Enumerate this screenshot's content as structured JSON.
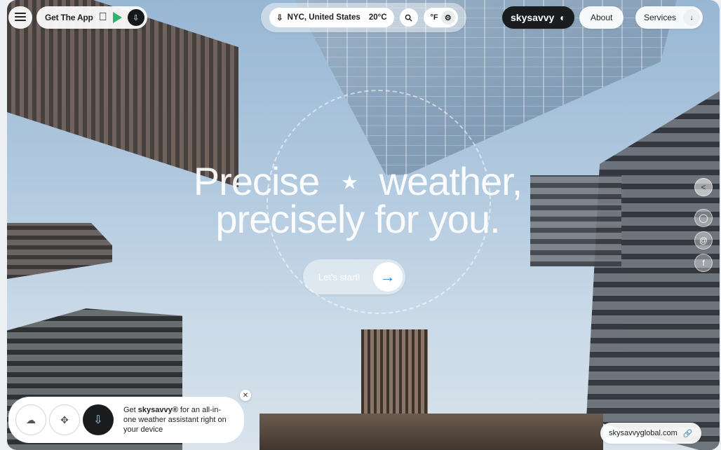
{
  "header": {
    "menu_icon": "hamburger-icon",
    "get_app_label": "Get The App",
    "location": "NYC, United States",
    "temperature": "20°C",
    "unit_label": "°F",
    "brand": "skysavvy",
    "about_label": "About",
    "services_label": "Services"
  },
  "hero": {
    "line1_a": "Precise",
    "line1_b": "weather,",
    "line2": "precisely for you.",
    "cta_label": "Let's start!"
  },
  "social": {
    "icons": [
      "share-icon",
      "instagram-icon",
      "threads-icon",
      "facebook-icon"
    ]
  },
  "promo": {
    "text_pre": "Get ",
    "brand": "skysavvy®",
    "text_post": " for an all-in-one weather assistant right on your device"
  },
  "footer": {
    "site": "skysavvyglobal.com"
  },
  "colors": {
    "accent": "#2a7fd8",
    "dark": "#1b1c1e",
    "sky": "#98b7d3"
  }
}
